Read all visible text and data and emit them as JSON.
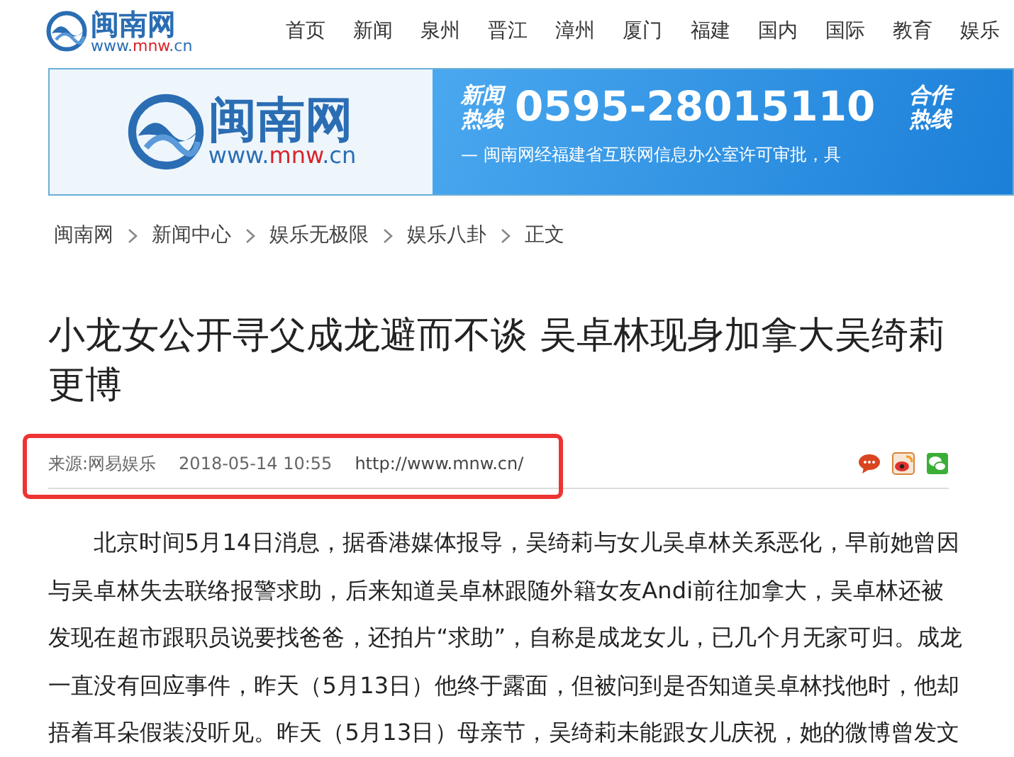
{
  "header": {
    "logo_text": "闽南网",
    "logo_url": [
      "www.",
      "mnw",
      ".cn"
    ],
    "nav": [
      "首页",
      "新闻",
      "泉州",
      "晋江",
      "漳州",
      "厦门",
      "福建",
      "国内",
      "国际",
      "教育",
      "娱乐"
    ]
  },
  "banner": {
    "logo_text": "闽南网",
    "logo_url": [
      "www.",
      "mnw",
      ".cn"
    ],
    "hotline_label": [
      "新闻",
      "热线"
    ],
    "hotline_number": "0595-28015110",
    "second_label": [
      "合作",
      "热线"
    ],
    "tagline": "— 闽南网经福建省互联网信息办公室许可审批，具"
  },
  "breadcrumb": [
    "闽南网",
    "新闻中心",
    "娱乐无极限",
    "娱乐八卦",
    "正文"
  ],
  "article": {
    "title": "小龙女公开寻父成龙避而不谈 吴卓林现身加拿大吴绮莉更博",
    "meta": {
      "highlighted": true,
      "source": "来源:网易娱乐",
      "time": "2018-05-14 10:55",
      "url": "http://www.mnw.cn/"
    },
    "share": [
      {
        "kind": "comment"
      },
      {
        "kind": "weibo"
      },
      {
        "kind": "wechat"
      }
    ],
    "paragraph": "北京时间5月14日消息，据香港媒体报导，吴绮莉与女儿吴卓林关系恶化，早前她曾因与吴卓林失去联络报警求助，后来知道吴卓林跟随外籍女友Andi前往加拿大，吴卓林还被发现在超市跟职员说要找爸爸，还拍片“求助”，自称是成龙女儿，已几个月无家可归。成龙一直没有回应事件，昨天（5月13日）他终于露面，但被问到是否知道吴卓林找他时，他却捂着耳朵假装没听见。昨天（5月13日）母亲节，吴绮莉未能跟女儿庆祝，她的微博曾发文"
  }
}
